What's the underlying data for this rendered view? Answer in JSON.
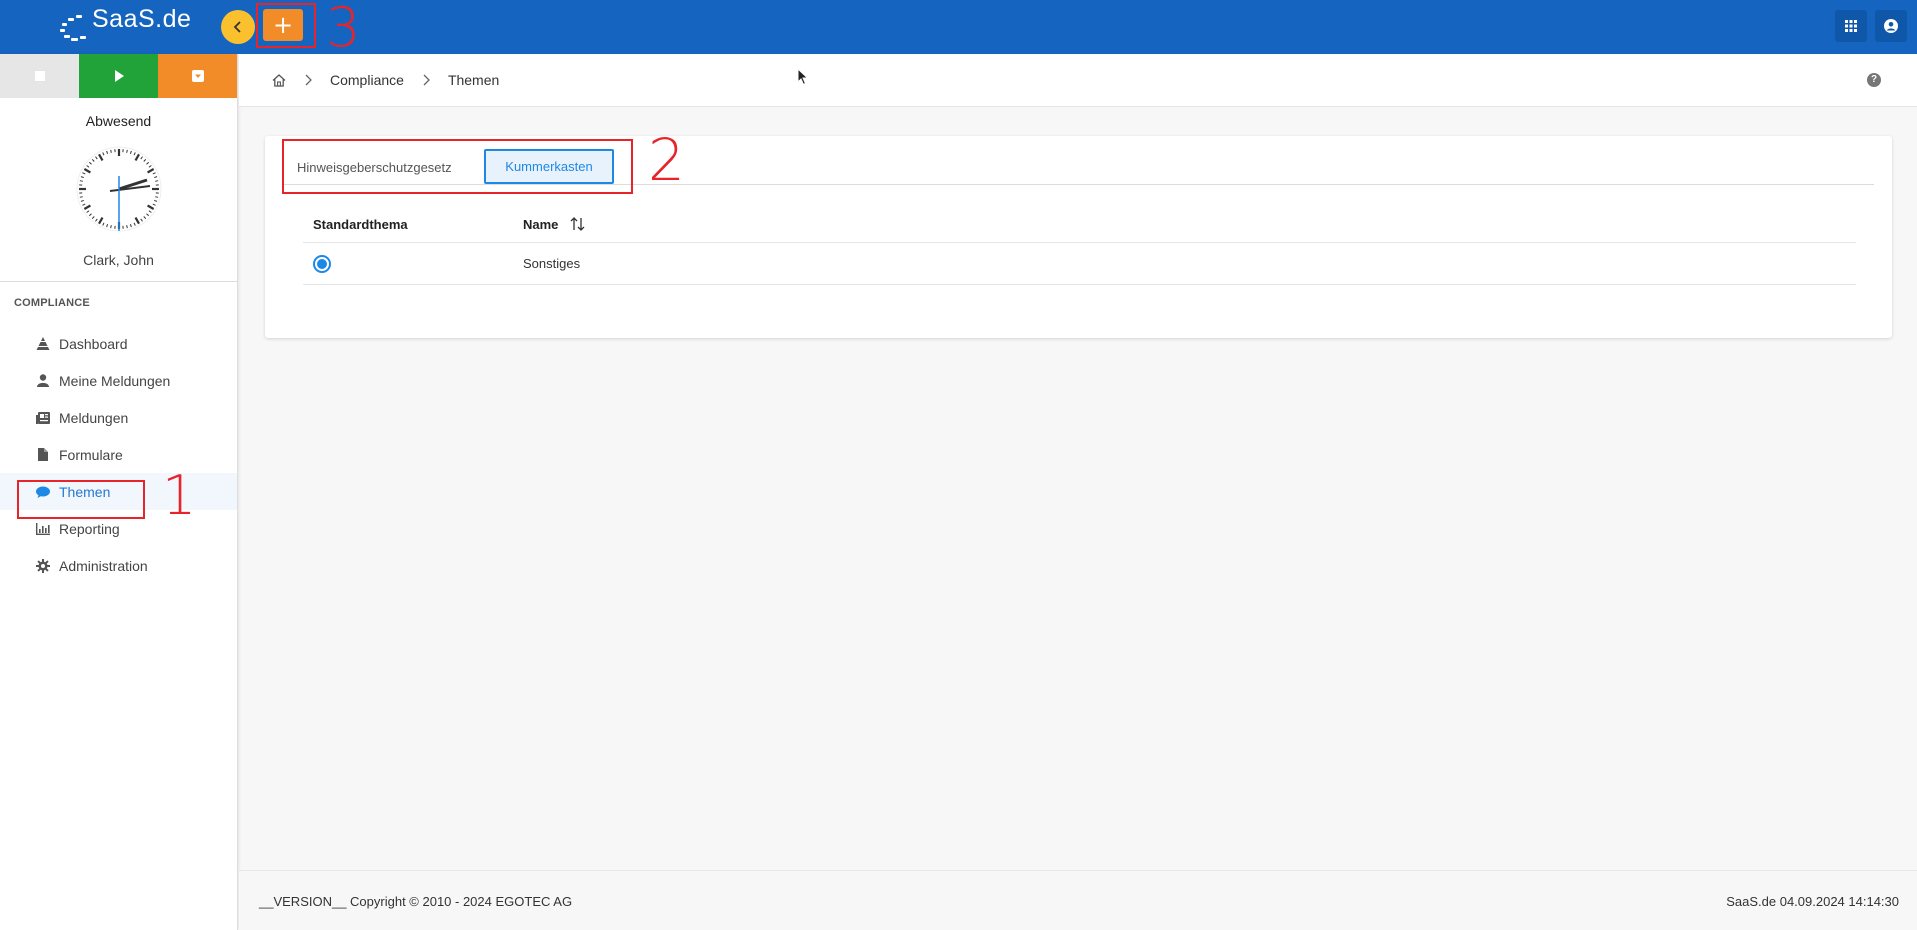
{
  "header": {
    "logo_text": "SaaS.de",
    "add_label": "+",
    "icons": [
      "chevron-left-icon",
      "apps-grid-icon",
      "user-circle-icon"
    ]
  },
  "annotations": [
    "1",
    "2",
    "3"
  ],
  "sidebar": {
    "time_buttons": [
      "stop-icon",
      "play-icon",
      "dropdown-icon"
    ],
    "status": "Abwesend",
    "user": "Clark, John",
    "section": "COMPLIANCE",
    "items": [
      {
        "label": "Dashboard",
        "icon": "dashboard-icon"
      },
      {
        "label": "Meine Meldungen",
        "icon": "user-icon"
      },
      {
        "label": "Meldungen",
        "icon": "newspaper-icon"
      },
      {
        "label": "Formulare",
        "icon": "file-icon"
      },
      {
        "label": "Themen",
        "icon": "comment-icon",
        "active": true
      },
      {
        "label": "Reporting",
        "icon": "chart-icon"
      },
      {
        "label": "Administration",
        "icon": "gear-icon"
      }
    ]
  },
  "breadcrumb": {
    "items": [
      "Compliance",
      "Themen"
    ]
  },
  "tabs": [
    "Hinweisgeberschutzgesetz",
    "Kummerkasten"
  ],
  "table": {
    "columns": [
      "Standardthema",
      "Name"
    ],
    "rows": [
      {
        "default": true,
        "name": "Sonstiges"
      }
    ]
  },
  "footer": {
    "left": "__VERSION__ Copyright © 2010 - 2024 EGOTEC AG",
    "right": "SaaS.de  04.09.2024 14:14:30"
  },
  "colors": {
    "topbar": "#1565c0",
    "accent": "#1e88e5",
    "add_button": "#f28c28",
    "collapse_button": "#fbc02d",
    "annotation": "#e8242b"
  }
}
